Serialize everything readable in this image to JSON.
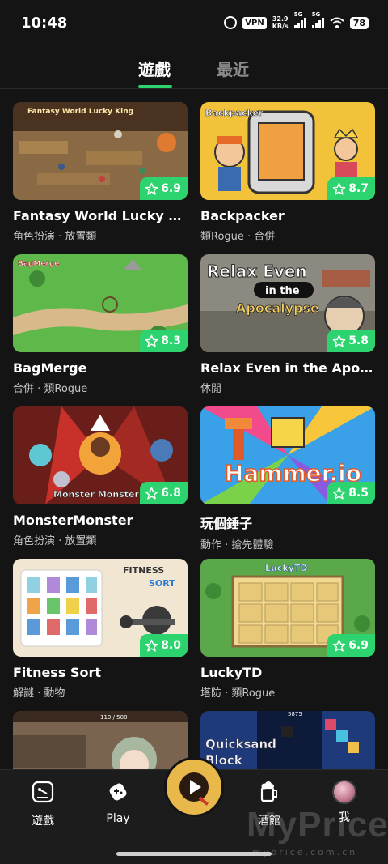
{
  "status_bar": {
    "time": "10:48",
    "vpn": "VPN",
    "speed_value": "32.9",
    "speed_unit": "KB/s",
    "signal1": "5G",
    "signal2": "5G",
    "battery": "78"
  },
  "tabs": [
    {
      "label": "遊戲",
      "active": true
    },
    {
      "label": "最近",
      "active": false
    }
  ],
  "games": [
    {
      "title": "Fantasy World Lucky King",
      "tags": "角色扮演 · 放置類",
      "rating": "6.9",
      "thumb_text": "Fantasy World Lucky King"
    },
    {
      "title": "Backpacker",
      "tags": "類Rogue · 合併",
      "rating": "8.7",
      "thumb_text": "Backpacker"
    },
    {
      "title": "BagMerge",
      "tags": "合併 · 類Rogue",
      "rating": "8.3",
      "thumb_text": "BagMerge"
    },
    {
      "title": "Relax Even in the Apocaly...",
      "tags": "休閒",
      "rating": "5.8",
      "thumb_text_1": "Relax Even",
      "thumb_text_2": "in the",
      "thumb_text_3": "Apocalypse"
    },
    {
      "title": "MonsterMonster",
      "tags": "角色扮演 · 放置類",
      "rating": "6.8",
      "thumb_text": "Monster Monster"
    },
    {
      "title": "玩個錘子",
      "tags": "動作 · 搶先體驗",
      "rating": "8.5",
      "thumb_text": "Hammer.io"
    },
    {
      "title": "Fitness Sort",
      "tags": "解謎 · 動物",
      "rating": "8.0",
      "thumb_text_1": "FITNESS",
      "thumb_text_2": "SORT"
    },
    {
      "title": "LuckyTD",
      "tags": "塔防 · 類Rogue",
      "rating": "6.9",
      "thumb_text": "LuckyTD"
    },
    {
      "thumb_text": "110 / 500"
    },
    {
      "thumb_text_1": "Quicksand",
      "thumb_text_2": "Block",
      "thumb_text_3": "5875"
    }
  ],
  "bottom_nav": {
    "games_label": "遊戲",
    "play_label": "Play",
    "pub_label": "酒館",
    "me_label": "我"
  },
  "watermark": "MyPrice",
  "watermark_sub": "myprice.com.cn",
  "colors": {
    "accent": "#2dd36f",
    "background": "#141414",
    "nav_background": "#1c1c1c",
    "center_button": "#e8b84a"
  },
  "icons": [
    "alarm-icon",
    "wifi-icon",
    "star-icon",
    "gamepad-icon",
    "play-icon",
    "beer-icon"
  ]
}
